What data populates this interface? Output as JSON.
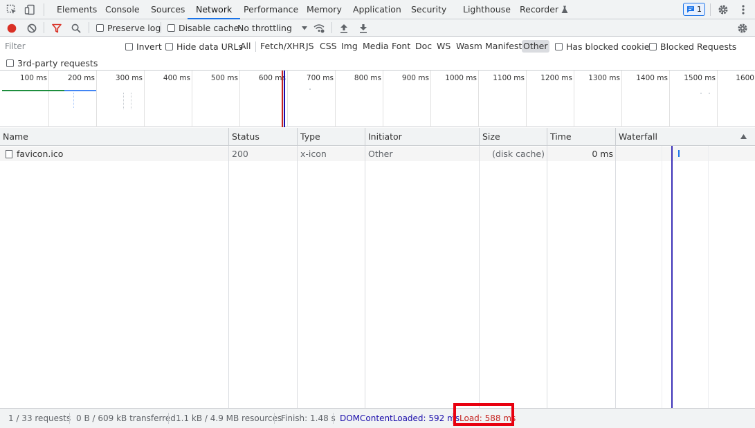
{
  "tabs": [
    {
      "label": "Elements"
    },
    {
      "label": "Console"
    },
    {
      "label": "Sources"
    },
    {
      "label": "Network"
    },
    {
      "label": "Performance"
    },
    {
      "label": "Memory"
    },
    {
      "label": "Application"
    },
    {
      "label": "Security"
    },
    {
      "label": "Lighthouse"
    },
    {
      "label": "Recorder"
    }
  ],
  "active_tab": "Network",
  "issues_badge": {
    "count": "1"
  },
  "toolbar": {
    "preserve_log": "Preserve log",
    "disable_cache": "Disable cache",
    "throttling": "No throttling"
  },
  "filter": {
    "placeholder": "Filter",
    "invert": "Invert",
    "hide_data_urls": "Hide data URLs",
    "resource_types": [
      "All",
      "Fetch/XHR",
      "JS",
      "CSS",
      "Img",
      "Media",
      "Font",
      "Doc",
      "WS",
      "Wasm",
      "Manifest",
      "Other"
    ],
    "selected_type": "Other",
    "has_blocked_cookies": "Has blocked cookies",
    "blocked_requests": "Blocked Requests",
    "third_party": "3rd-party requests"
  },
  "overview": {
    "ticks": [
      "100 ms",
      "200 ms",
      "300 ms",
      "400 ms",
      "500 ms",
      "600 ms",
      "700 ms",
      "800 ms",
      "900 ms",
      "1000 ms",
      "1100 ms",
      "1200 ms",
      "1300 ms",
      "1400 ms",
      "1500 ms",
      "1600"
    ]
  },
  "table": {
    "columns": [
      "Name",
      "Status",
      "Type",
      "Initiator",
      "Size",
      "Time",
      "Waterfall"
    ],
    "rows": [
      {
        "name": "favicon.ico",
        "status": "200",
        "type": "x-icon",
        "initiator": "Other",
        "size": "(disk cache)",
        "time": "0 ms"
      }
    ]
  },
  "status": {
    "requests": "1 / 33 requests",
    "transferred": "0 B / 609 kB transferred",
    "resources": "1.1 kB / 4.9 MB resources",
    "finish": "Finish: 1.48 s",
    "dom_content_loaded": "DOMContentLoaded: 592 ms",
    "load": "Load: 588 ms"
  },
  "colors": {
    "accent": "#1a73e8",
    "record": "#d93025",
    "filter_icon": "#d93025",
    "highlight_box": "#e8000f",
    "dcl_line": "#1a0dab",
    "load_line": "#c5221f"
  }
}
